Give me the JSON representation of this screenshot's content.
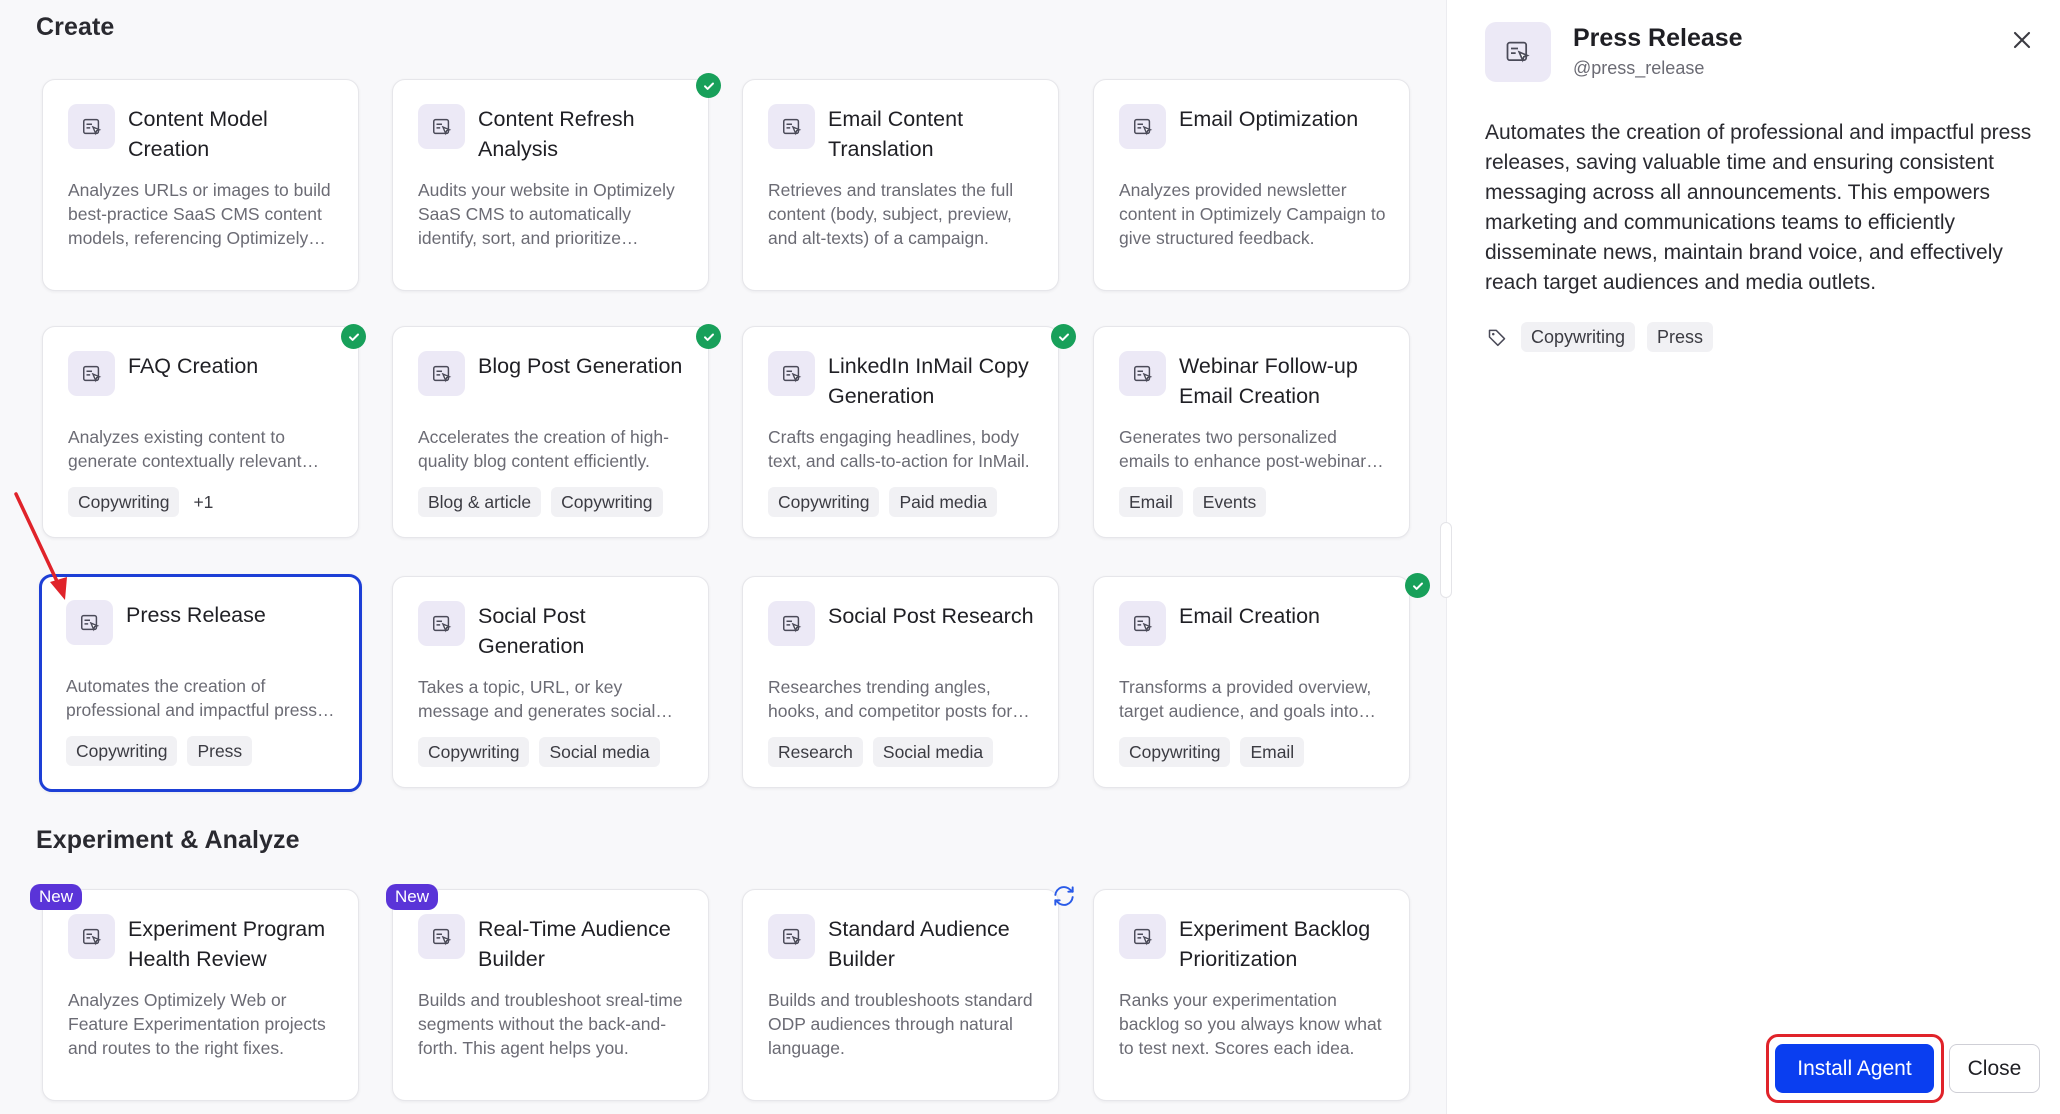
{
  "sections": {
    "create": "Create",
    "experiment": "Experiment & Analyze"
  },
  "cards": [
    {
      "title": "Content Model Creation",
      "desc": "Analyzes URLs or images to build best-practice SaaS CMS content models, referencing Optimizely documentation.",
      "tags": []
    },
    {
      "title": "Content Refresh Analysis",
      "desc": "Audits your website in Optimizely SaaS CMS to automatically identify, sort, and prioritize content.",
      "tags": []
    },
    {
      "title": "Email Content Translation",
      "desc": "Retrieves and translates the full content (body, subject, preview, and alt-texts) of a campaign.",
      "tags": []
    },
    {
      "title": "Email Optimization",
      "desc": "Analyzes provided newsletter content in Optimizely Campaign to give structured feedback.",
      "tags": []
    },
    {
      "title": "FAQ Creation",
      "desc": "Analyzes existing content to generate contextually relevant FAQs.",
      "tags": [
        "Copywriting"
      ],
      "extra": "+1"
    },
    {
      "title": "Blog Post Generation",
      "desc": "Accelerates the creation of high-quality blog content efficiently.",
      "tags": [
        "Blog & article",
        "Copywriting"
      ]
    },
    {
      "title": "LinkedIn InMail Copy Generation",
      "desc": "Crafts engaging headlines, body text, and calls-to-action for InMail.",
      "tags": [
        "Copywriting",
        "Paid media"
      ]
    },
    {
      "title": "Webinar Follow-up Email Creation",
      "desc": "Generates two personalized emails to enhance post-webinar engagement.",
      "tags": [
        "Email",
        "Events"
      ]
    },
    {
      "title": "Press Release",
      "desc": "Automates the creation of professional and impactful press releases.",
      "tags": [
        "Copywriting",
        "Press"
      ]
    },
    {
      "title": "Social Post Generation",
      "desc": "Takes a topic, URL, or key message and generates social posts.",
      "tags": [
        "Copywriting",
        "Social media"
      ]
    },
    {
      "title": "Social Post Research",
      "desc": "Researches trending angles, hooks, and competitor posts for you.",
      "tags": [
        "Research",
        "Social media"
      ]
    },
    {
      "title": "Email Creation",
      "desc": "Transforms a provided overview, target audience, and goals into emails.",
      "tags": [
        "Copywriting",
        "Email"
      ]
    },
    {
      "title": "Experiment Program Health Review",
      "desc": "Analyzes Optimizely Web or Feature Experimentation projects and routes to the right fixes.",
      "tags": [],
      "badge": "New"
    },
    {
      "title": "Real-Time Audience Builder",
      "desc": "Builds and troubleshoot sreal-time segments without the back-and-forth. This agent helps you.",
      "tags": [],
      "badge": "New"
    },
    {
      "title": "Standard Audience Builder",
      "desc": "Builds and troubleshoots standard ODP audiences through natural language.",
      "tags": []
    },
    {
      "title": "Experiment Backlog Prioritization",
      "desc": "Ranks your experimentation backlog so you always know what to test next. Scores each idea.",
      "tags": []
    }
  ],
  "panel": {
    "title": "Press Release",
    "handle": "@press_release",
    "description": "Automates the creation of professional and impactful press releases, saving valuable time and ensuring consistent messaging across all announcements. This empowers marketing and communications teams to efficiently disseminate news, maintain brand voice, and effectively reach target audiences and media outlets.",
    "tags": [
      "Copywriting",
      "Press"
    ],
    "install_label": "Install Agent",
    "close_label": "Close"
  },
  "colors": {
    "accent": "#0a3ef0",
    "selected_border": "#1d3fd6",
    "check": "#18a05a",
    "new_badge": "#5a34d8",
    "highlight": "#e0232a"
  }
}
